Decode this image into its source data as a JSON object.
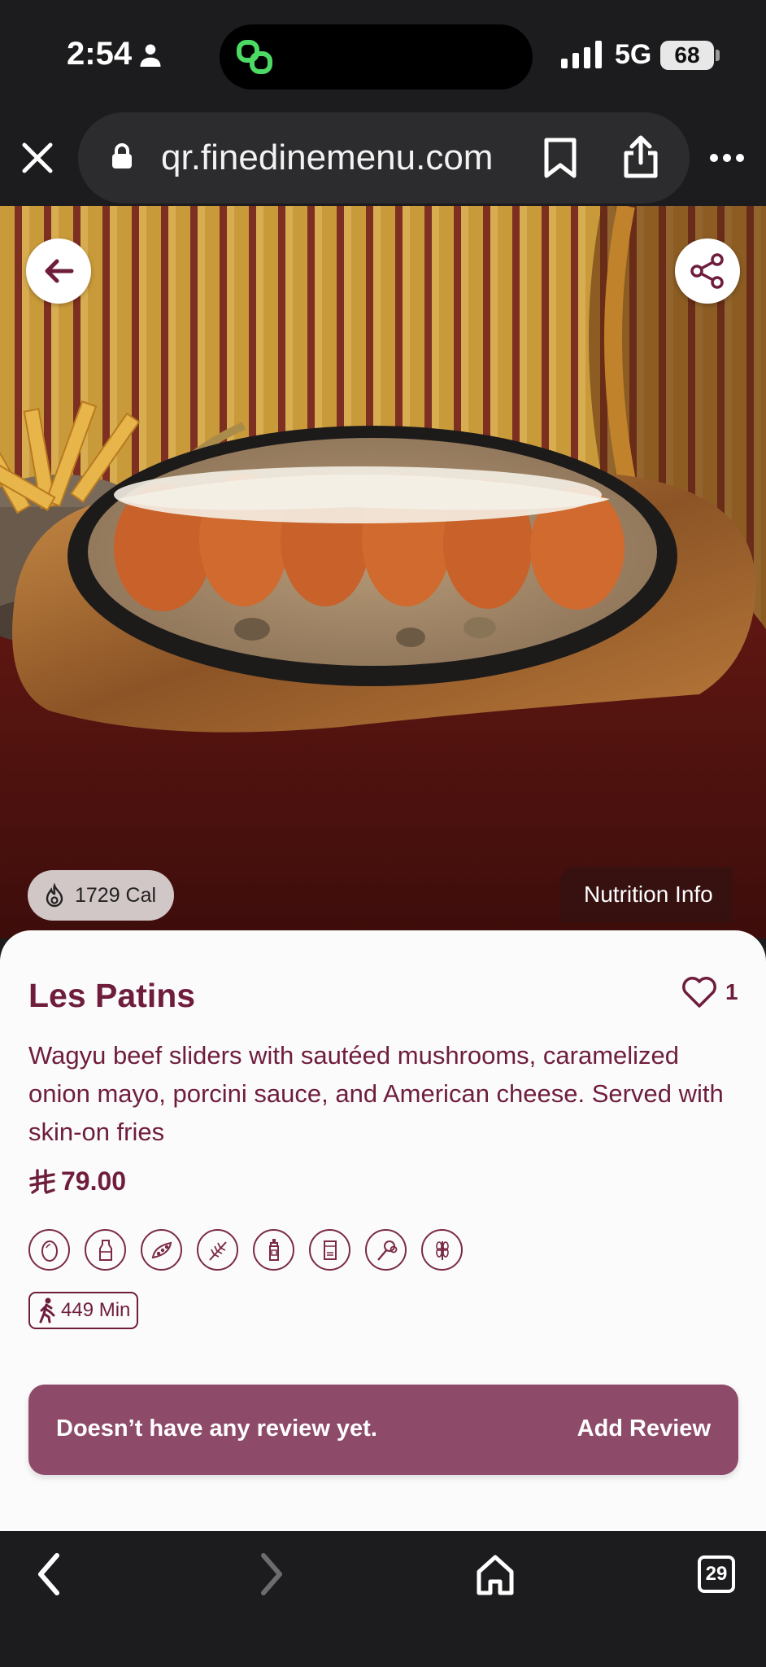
{
  "status_bar": {
    "time": "2:54",
    "network": "5G",
    "battery": "68"
  },
  "browser": {
    "url": "qr.finedinemenu.com"
  },
  "hero": {
    "calories": "1729 Cal",
    "nutrition_label": "Nutrition Info"
  },
  "item": {
    "title": "Les Patins",
    "likes": "1",
    "description": " Wagyu beef sliders with sautéed mushrooms, caramelized onion mayo, porcini sauce, and American cheese. Served with skin-on fries",
    "price": "79.00",
    "allergen_icons": [
      "egg-icon",
      "milk-icon",
      "soy-icon",
      "wheat-icon",
      "mustard-icon",
      "sulphite-icon",
      "celery-icon",
      "gluten-icon"
    ],
    "prep_time": "449 Min"
  },
  "reviews": {
    "empty_text": "Doesn’t have any review yet.",
    "add_label": "Add Review"
  },
  "nav": {
    "tab_count": "29"
  },
  "colors": {
    "brand": "#6e1d3d",
    "review_bar": "#8e4b69",
    "chrome": "#1c1c1e"
  }
}
